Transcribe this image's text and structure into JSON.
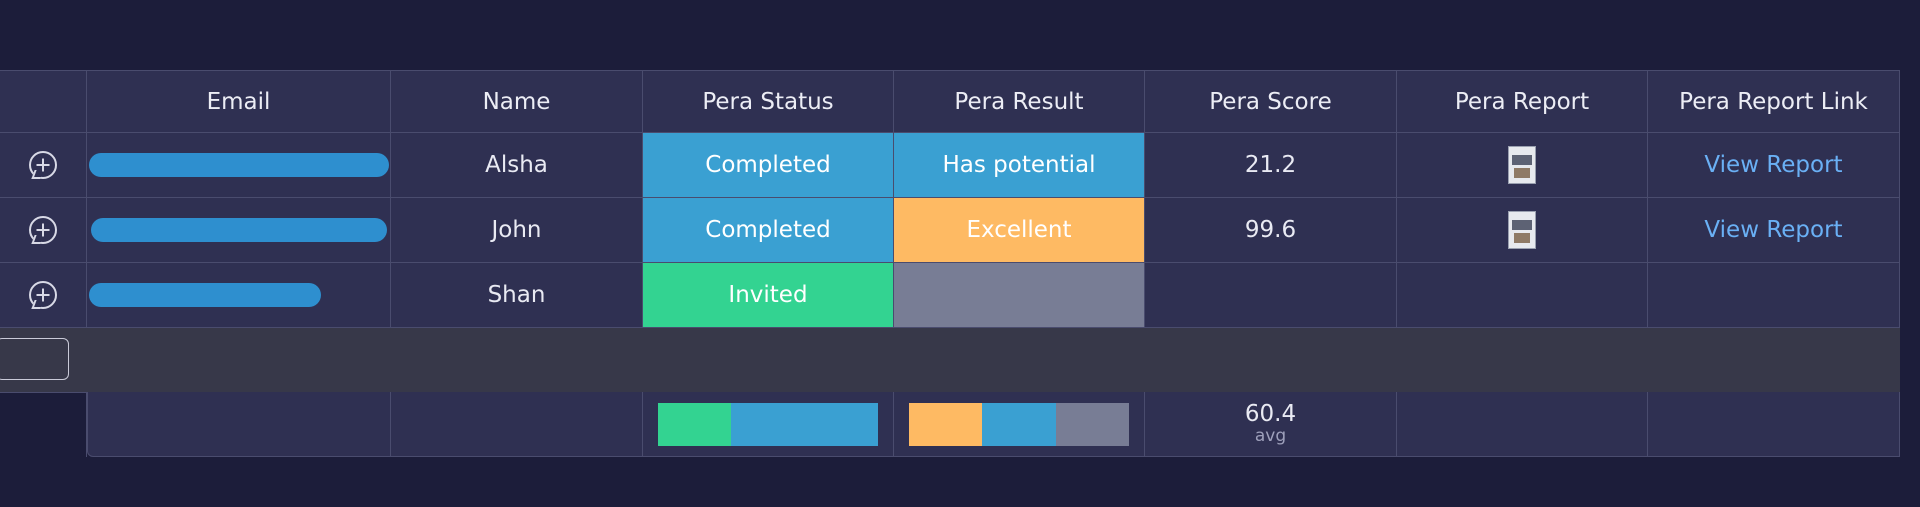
{
  "columns": [
    "",
    "Email",
    "Name",
    "Pera Status",
    "Pera Result",
    "Pera Score",
    "Pera Report",
    "Pera Report Link"
  ],
  "rows": [
    {
      "name": "Alsha",
      "status": "Completed",
      "result": "Has potential",
      "score": "21.2",
      "report_icon": "report-thumbnail-icon",
      "link": "View Report"
    },
    {
      "name": "John",
      "status": "Completed",
      "result": "Excellent",
      "score": "99.6",
      "report_icon": "report-thumbnail-icon",
      "link": "View Report"
    },
    {
      "name": "Shan",
      "status": "Invited",
      "result": "",
      "score": "",
      "report_icon": "",
      "link": ""
    }
  ],
  "footer": {
    "avg_value": "60.4",
    "avg_label": "avg",
    "status_summary": [
      {
        "label": "Invited",
        "fraction": 0.333,
        "color": "#33d391"
      },
      {
        "label": "Completed",
        "fraction": 0.667,
        "color": "#3aa0d2"
      }
    ],
    "result_summary": [
      {
        "label": "Excellent",
        "fraction": 0.333,
        "color": "#feba63"
      },
      {
        "label": "Has potential",
        "fraction": 0.333,
        "color": "#3aa0d2"
      },
      {
        "label": "",
        "fraction": 0.334,
        "color": "#787d95"
      }
    ]
  },
  "colors": {
    "background": "#1c1d3a",
    "cell": "#2f3052",
    "completed": "#3aa0d2",
    "invited": "#33d391",
    "excellent": "#feba63",
    "has_potential": "#3aa0d2",
    "empty_result": "#787d95",
    "link": "#6ab0f5"
  },
  "icons": {
    "row_action": "add-update-icon",
    "email_redaction": "redacted-email"
  }
}
